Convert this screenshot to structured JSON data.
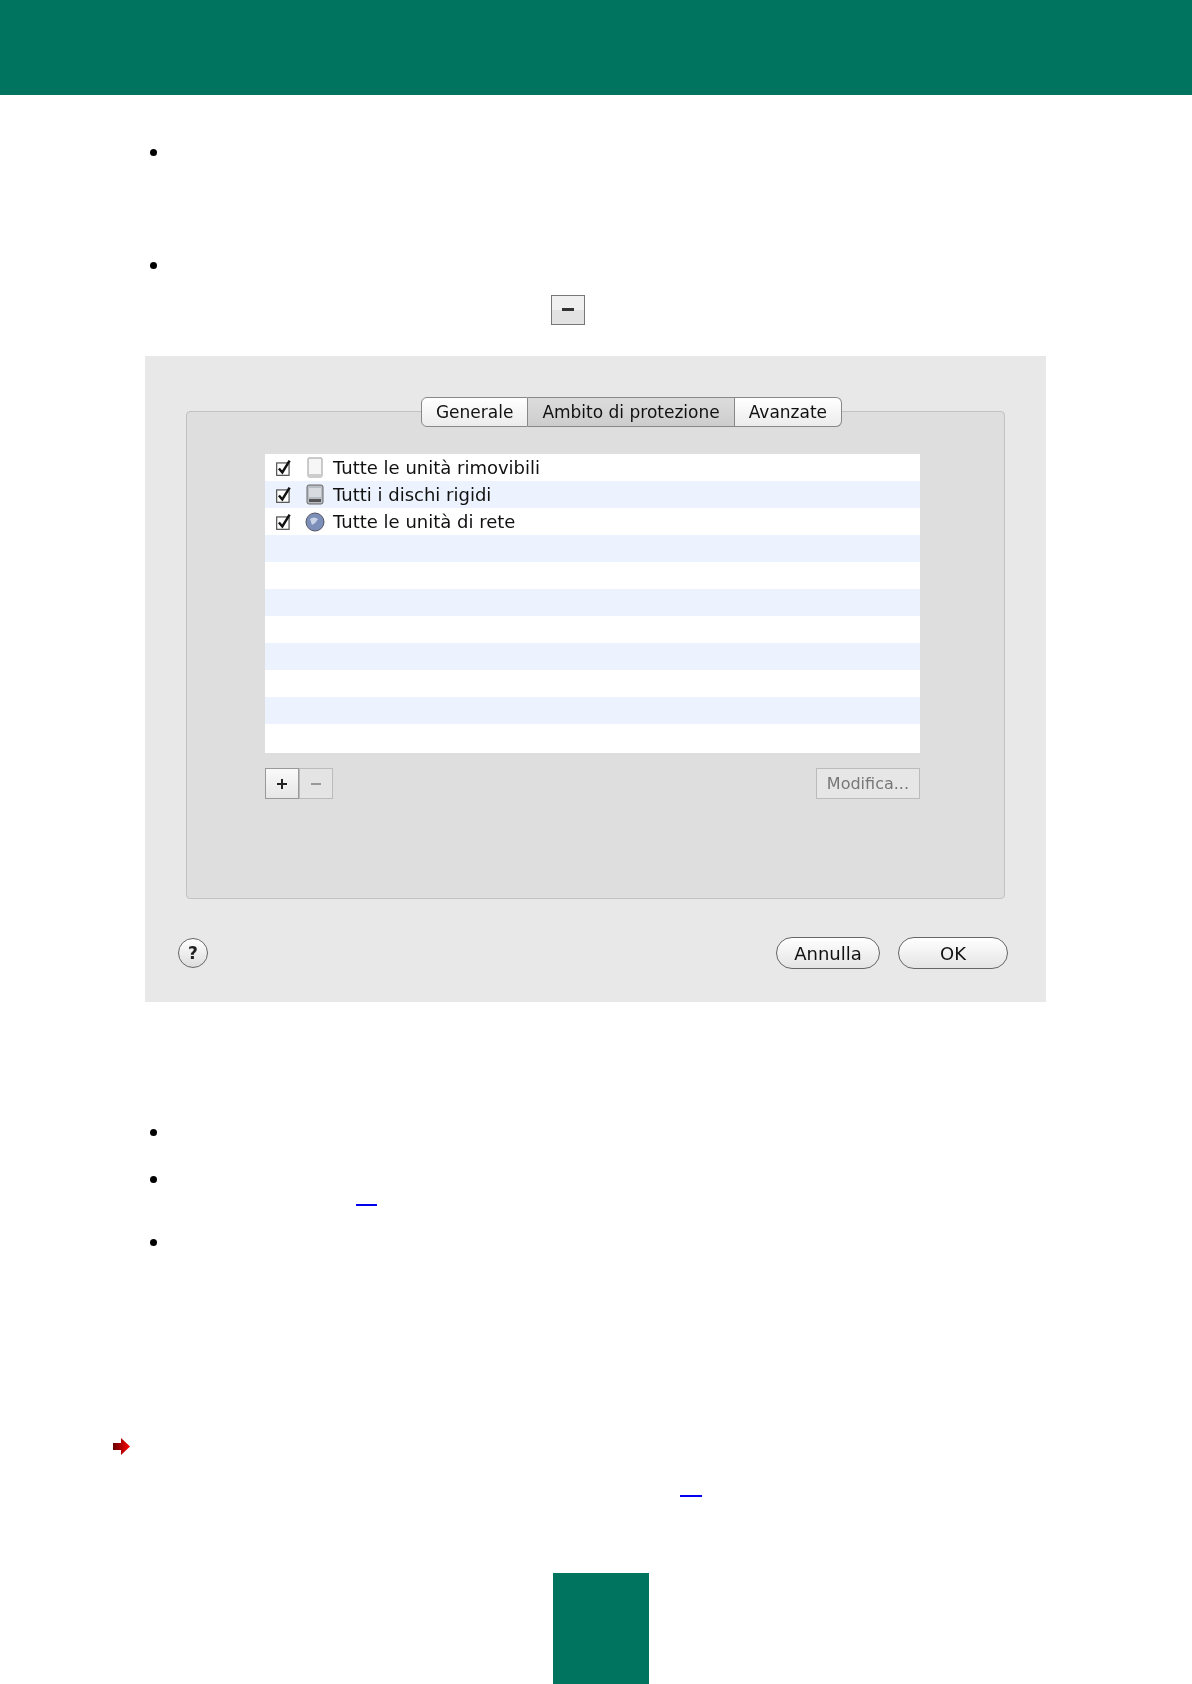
{
  "dialog": {
    "tabs": [
      {
        "label": "Generale",
        "selected": false
      },
      {
        "label": "Ambito di protezione",
        "selected": true
      },
      {
        "label": "Avanzate",
        "selected": false
      }
    ],
    "scope_list": [
      {
        "label": "Tutte le unità rimovibili",
        "checked": true,
        "kind": "removable"
      },
      {
        "label": "Tutti i dischi rigidi",
        "checked": true,
        "kind": "harddisk"
      },
      {
        "label": "Tutte le unità di rete",
        "checked": true,
        "kind": "network"
      }
    ],
    "list_buttons": [
      {
        "kind": "add",
        "disabled": false
      },
      {
        "kind": "remove",
        "disabled": true
      }
    ],
    "edit_button": {
      "label": "Modifica...",
      "disabled": true
    },
    "help_button": {
      "label": "?"
    },
    "buttons": [
      {
        "label": "Annulla",
        "default": false
      },
      {
        "label": "OK",
        "default": false
      }
    ]
  }
}
